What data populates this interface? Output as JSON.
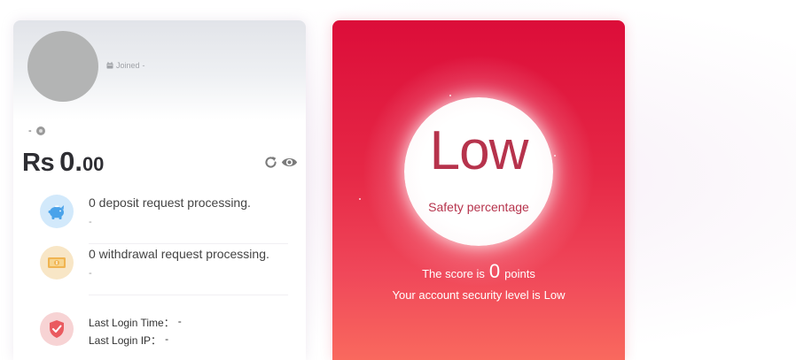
{
  "account": {
    "joined_label": "Joined",
    "joined_value": "-",
    "username": "-",
    "balance": {
      "currency": "Rs",
      "integer": "0.",
      "decimals": "00"
    },
    "deposit": {
      "title": "0 deposit request processing.",
      "sub": "-"
    },
    "withdrawal": {
      "title": "0 withdrawal request processing.",
      "sub": "-"
    },
    "login": {
      "time_label": "Last Login Time：",
      "time_value": "-",
      "ip_label": "Last Login IP：",
      "ip_value": "-"
    }
  },
  "security": {
    "level": "Low",
    "safety_label": "Safety percentage",
    "score_prefix": "The score is",
    "score": "0",
    "score_suffix": "points",
    "level_prefix": "Your account security level is",
    "level_value": "Low"
  },
  "icons": {
    "calendar": "calendar-icon",
    "refresh": "refresh-icon",
    "eye": "eye-icon",
    "deposit": "piggy-bank-icon",
    "withdrawal": "cash-icon",
    "security": "shield-check-icon"
  },
  "colors": {
    "security_card_top": "#dc0d39",
    "security_card_bottom": "#f9695e",
    "level_text": "#b6334c",
    "deposit_icon": "#4aa3ea",
    "withdraw_icon": "#f0b451",
    "security_icon": "#ea5a5f"
  }
}
